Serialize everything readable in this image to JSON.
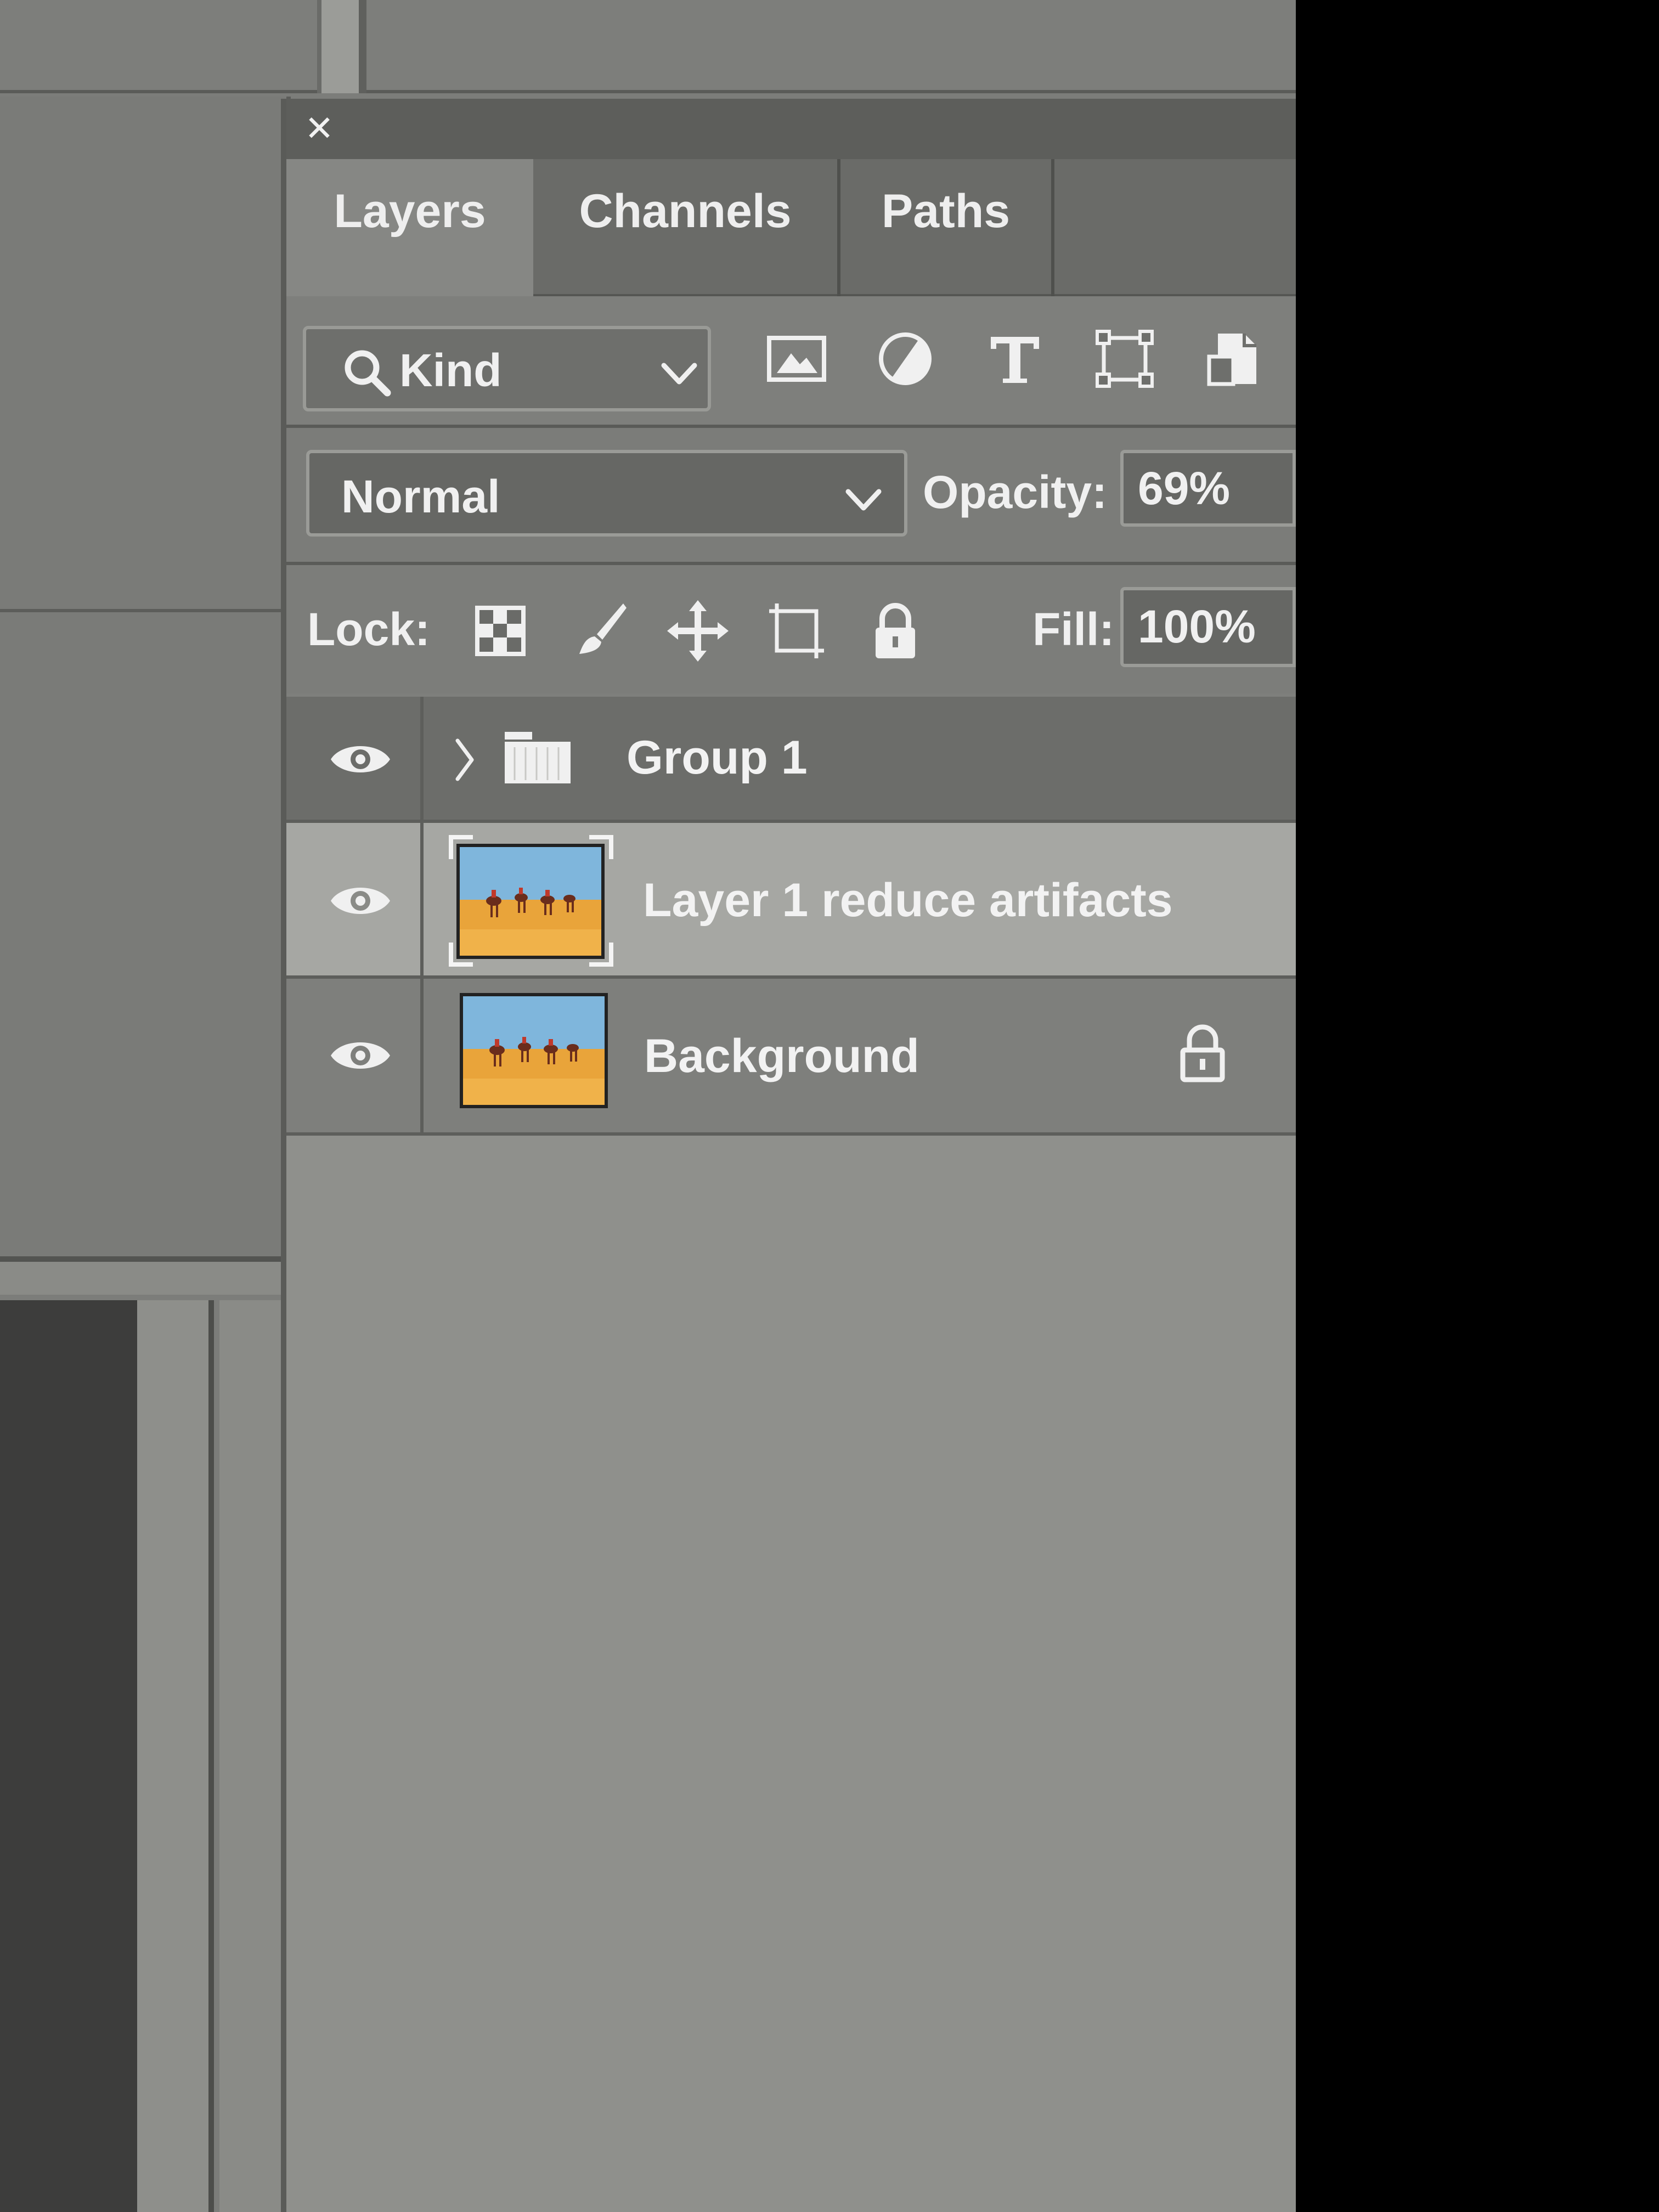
{
  "panel": {
    "tabs": [
      {
        "label": "Layers",
        "active": true
      },
      {
        "label": "Channels",
        "active": false
      },
      {
        "label": "Paths",
        "active": false
      }
    ],
    "filter": {
      "kind_label": "Kind",
      "icons": [
        "image-filter-icon",
        "adjustment-filter-icon",
        "type-filter-icon",
        "shape-filter-icon",
        "smart-object-filter-icon"
      ]
    },
    "blend_mode": "Normal",
    "opacity_label": "Opacity:",
    "opacity_value": "69%",
    "lock_label": "Lock:",
    "lock_icons": [
      "lock-transparent-pixels-icon",
      "lock-image-pixels-icon",
      "lock-position-icon",
      "lock-artboard-icon",
      "lock-all-icon"
    ],
    "fill_label": "Fill:",
    "fill_value": "100%",
    "layers": [
      {
        "name": "Group 1",
        "type": "group",
        "visible": true,
        "selected": false
      },
      {
        "name": "Layer 1 reduce artifacts",
        "type": "image",
        "visible": true,
        "selected": true
      },
      {
        "name": "Background",
        "type": "image",
        "visible": true,
        "selected": false,
        "locked": true
      }
    ]
  },
  "colors": {
    "panel_bg": "#7e7f7c",
    "selected_row": "#a6a7a3",
    "thumb_sky": "#7fb6dc",
    "thumb_sand": "#e9a43a"
  }
}
